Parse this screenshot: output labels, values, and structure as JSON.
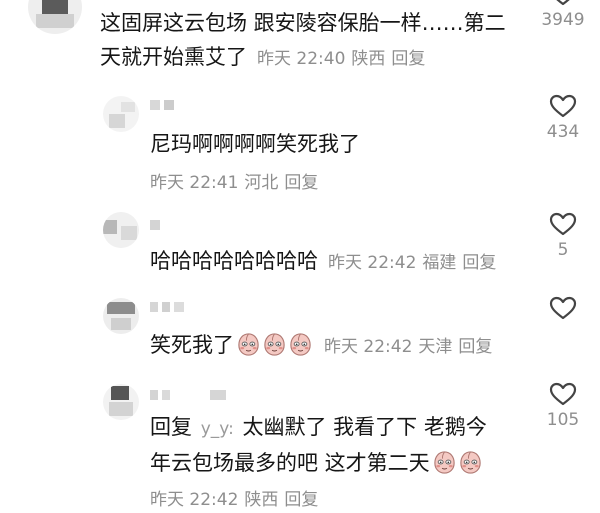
{
  "colors": {
    "text": "#161616",
    "meta": "#8e8e8e",
    "heart": "#444444",
    "emoji_face": "#f4c9c3",
    "emoji_blush": "#e0908a"
  },
  "icons": {
    "like": "heart-outline-icon",
    "emoji": "peach-face-emoji-icon"
  },
  "comments": [
    {
      "username": "",
      "text_lines": [
        "这固屏这云包场 跟安陵容保胎一样……第二",
        "天就开始熏艾了"
      ],
      "time": "昨天 22:40",
      "location": "陕西",
      "reply_label": "回复",
      "likes": "3949"
    },
    {
      "username": "",
      "text_lines": [
        "尼玛啊啊啊啊笑死我了"
      ],
      "time": "昨天 22:41",
      "location": "河北",
      "reply_label": "回复",
      "likes": "434"
    },
    {
      "username": "",
      "text_lines": [
        "哈哈哈哈哈哈哈哈"
      ],
      "time": "昨天 22:42",
      "location": "福建",
      "reply_label": "回复",
      "likes": "5"
    },
    {
      "username": "",
      "text_lines": [
        "笑死我了"
      ],
      "emoji_count": 3,
      "time": "昨天 22:42",
      "location": "天津",
      "reply_label": "回复",
      "likes": ""
    },
    {
      "username": "",
      "reply_prefix": "回复",
      "reply_to": "y_y:",
      "text_lines": [
        "太幽默了 我看了下 老鹅今",
        "年云包场最多的吧 这才第二天"
      ],
      "emoji_count": 2,
      "time": "昨天 22:42",
      "location": "陕西",
      "reply_label": "回复",
      "likes": "105"
    }
  ]
}
